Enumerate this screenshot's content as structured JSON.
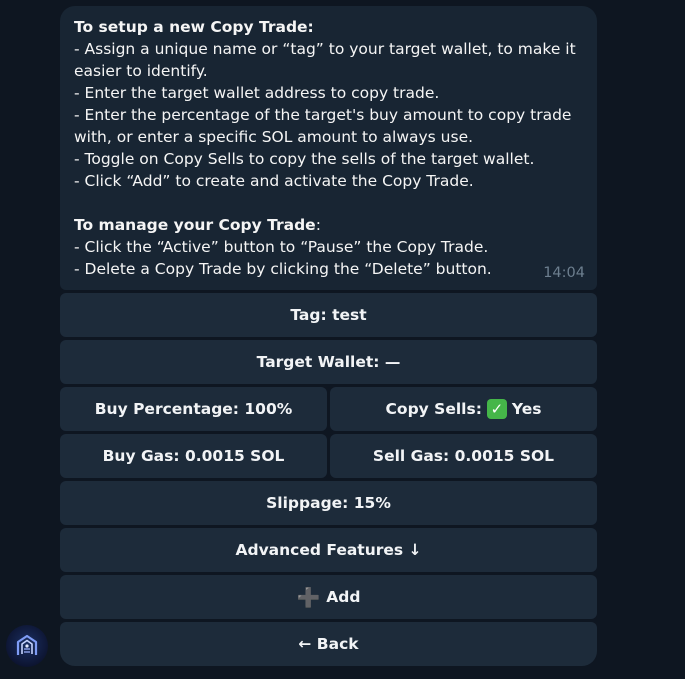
{
  "message": {
    "heading_setup": "To setup a new Copy Trade:",
    "setup_lines": [
      "- Assign a unique name or “tag” to your target wallet, to make it",
      "easier to identify.",
      "- Enter the target wallet address to copy trade.",
      "- Enter the percentage of the target's buy amount to copy trade",
      "with, or enter a specific SOL amount to always use.",
      "- Toggle on Copy Sells to copy the sells of the target wallet.",
      "- Click “Add” to create and activate the Copy Trade."
    ],
    "heading_manage": "To manage your Copy Trade",
    "heading_manage_colon": ":",
    "manage_lines": [
      "- Click the “Active” button to “Pause” the Copy Trade.",
      "- Delete a Copy Trade by clicking the “Delete” button."
    ],
    "time": "14:04"
  },
  "keyboard": {
    "tag": "Tag: test",
    "target_wallet": "Target Wallet: —",
    "buy_percentage": "Buy Percentage: 100%",
    "copy_sells_prefix": "Copy Sells:",
    "copy_sells_value": "Yes",
    "buy_gas": "Buy Gas: 0.0015 SOL",
    "sell_gas": "Sell Gas: 0.0015 SOL",
    "slippage": "Slippage: 15%",
    "advanced": "Advanced Features ↓",
    "add": "Add",
    "back": "← Back"
  },
  "icons": {
    "check": "check-mark-emoji",
    "plus": "heavy-plus-emoji",
    "avatar": "bot-avatar"
  },
  "colors": {
    "background": "#0e1621",
    "bubble": "#182533",
    "button": "#1d2b3a",
    "time": "#6d7f8f",
    "check": "#45b649"
  }
}
